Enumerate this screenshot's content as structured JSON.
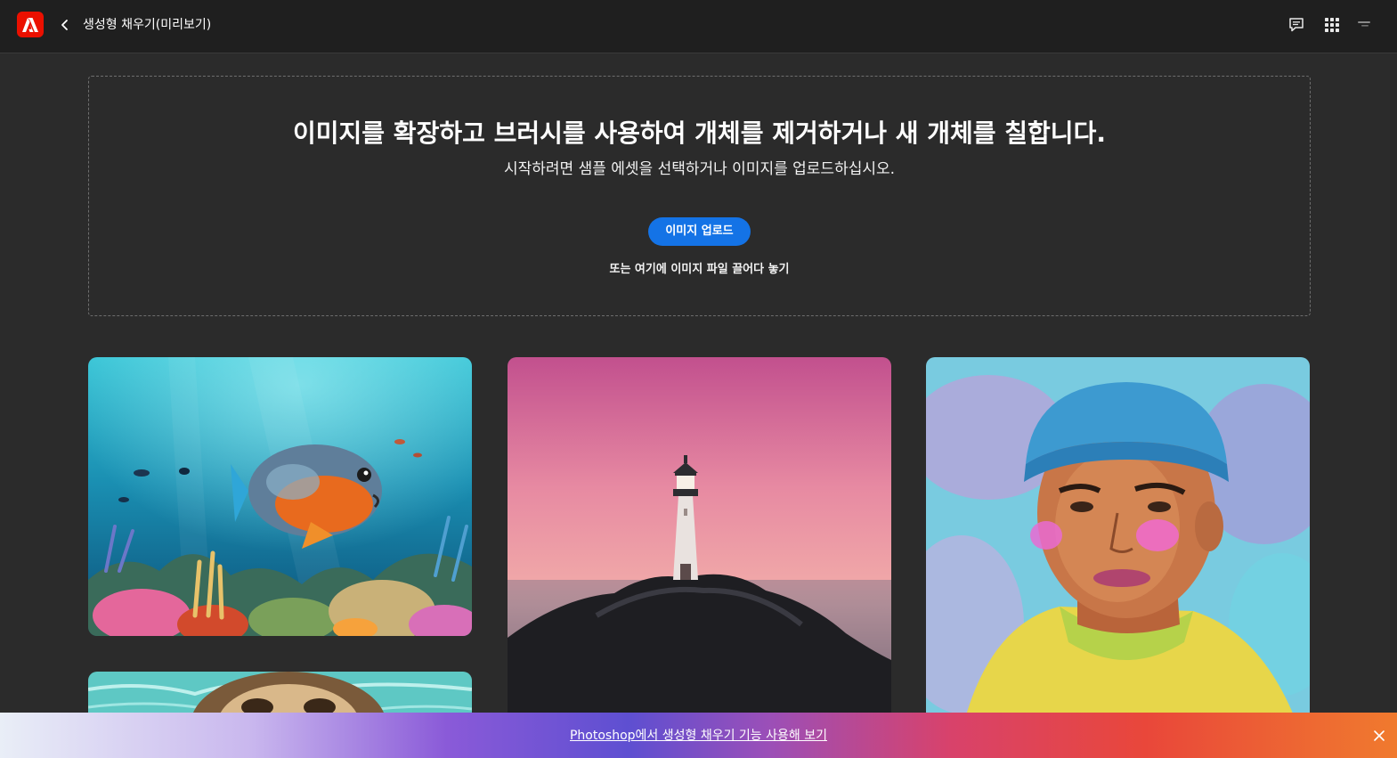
{
  "header": {
    "logo_icon": "adobe-logo",
    "back_icon": "chevron-left-icon",
    "title": "생성형 채우기(미리보기)",
    "chat_icon": "chat-icon",
    "apps_icon": "app-grid-icon",
    "profile_icon": "profile-icon"
  },
  "dropzone": {
    "headline": "이미지를 확장하고 브러시를 사용하여 개체를 제거하거나 새 개체를 칠합니다.",
    "subline": "시작하려면 샘플 에셋을 선택하거나 이미지를 업로드하십시오.",
    "upload_label": "이미지 업로드",
    "drop_hint": "또는 여기에 이미지 파일 끌어다 놓기"
  },
  "gallery": [
    {
      "name": "aquarium",
      "description": "underwater coral reef with fish"
    },
    {
      "name": "lighthouse",
      "description": "lighthouse on rocks at sunset"
    },
    {
      "name": "portrait",
      "description": "illustrated portrait of a young man in a beanie"
    },
    {
      "name": "sloth",
      "description": "sloth in water"
    }
  ],
  "promo": {
    "link_text": "Photoshop에서 생성형 채우기 기능 사용해 보기",
    "close_icon": "close-icon"
  },
  "colors": {
    "topbar": "#1f1f1f",
    "background": "#2b2b2b",
    "accent": "#1473e6",
    "brand": "#eb1000"
  }
}
